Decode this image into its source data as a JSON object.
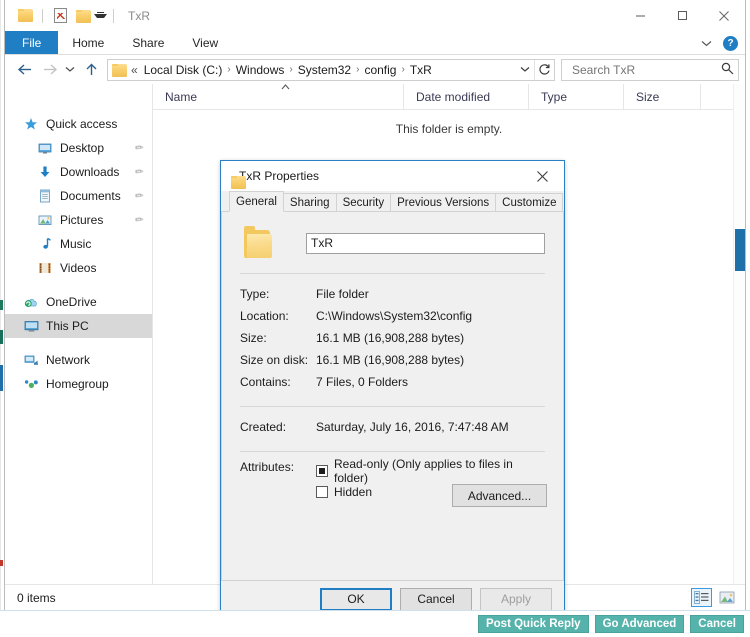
{
  "window": {
    "title": "TxR",
    "quick_access_toolbar": [
      {
        "name": "folder-icon",
        "tooltip": "TxR"
      },
      {
        "name": "properties-doc-icon",
        "tooltip": "Properties"
      },
      {
        "name": "new-folder-icon",
        "tooltip": "New folder"
      },
      {
        "name": "customize-caret-icon",
        "tooltip": "Customize Quick Access Toolbar"
      }
    ],
    "controls": {
      "minimize": "minimize-button",
      "maximize": "maximize-button",
      "close": "close-button"
    }
  },
  "ribbon": {
    "tabs": [
      {
        "label": "File",
        "active": true
      },
      {
        "label": "Home",
        "active": false
      },
      {
        "label": "Share",
        "active": false
      },
      {
        "label": "View",
        "active": false
      }
    ],
    "collapse_icon": "chevron-down-icon",
    "help_icon": "help-icon",
    "help_glyph": "?",
    "file_tab_color": "#1f7ec4"
  },
  "navigation": {
    "back_label": "Back",
    "forward_label": "Forward",
    "recent_label": "Recent locations",
    "up_label": "Up",
    "breadcrumb_prefix": "«",
    "breadcrumbs": [
      "Local Disk (C:)",
      "Windows",
      "System32",
      "config",
      "TxR"
    ],
    "separator": "›",
    "dropdown_icon": "chevron-down-icon",
    "refresh_icon": "refresh-icon"
  },
  "search": {
    "placeholder": "Search TxR",
    "value": "",
    "icon": "search-icon"
  },
  "sidebar": {
    "items": [
      {
        "label": "Quick access",
        "icon": "star-icon",
        "indent": false,
        "pinned": false,
        "selected": false
      },
      {
        "label": "Desktop",
        "icon": "desktop-icon",
        "indent": true,
        "pinned": true,
        "selected": false
      },
      {
        "label": "Downloads",
        "icon": "downloads-icon",
        "indent": true,
        "pinned": true,
        "selected": false
      },
      {
        "label": "Documents",
        "icon": "documents-icon",
        "indent": true,
        "pinned": true,
        "selected": false
      },
      {
        "label": "Pictures",
        "icon": "pictures-icon",
        "indent": true,
        "pinned": true,
        "selected": false
      },
      {
        "label": "Music",
        "icon": "music-icon",
        "indent": true,
        "pinned": false,
        "selected": false
      },
      {
        "label": "Videos",
        "icon": "videos-icon",
        "indent": true,
        "pinned": false,
        "selected": false
      },
      {
        "label": "OneDrive",
        "icon": "onedrive-icon",
        "indent": false,
        "pinned": false,
        "selected": false
      },
      {
        "label": "This PC",
        "icon": "this-pc-icon",
        "indent": false,
        "pinned": false,
        "selected": true
      },
      {
        "label": "Network",
        "icon": "network-icon",
        "indent": false,
        "pinned": false,
        "selected": false
      },
      {
        "label": "Homegroup",
        "icon": "homegroup-icon",
        "indent": false,
        "pinned": false,
        "selected": false
      }
    ]
  },
  "file_list": {
    "columns": [
      "Name",
      "Date modified",
      "Type",
      "Size"
    ],
    "sort_column": "Name",
    "sort_direction": "ascending",
    "rows": [],
    "empty_message": "This folder is empty."
  },
  "status_bar": {
    "item_count_text": "0 items",
    "view_buttons": [
      {
        "name": "details-view-button",
        "selected": true
      },
      {
        "name": "large-icons-view-button",
        "selected": false
      }
    ]
  },
  "dialog": {
    "title": "TxR Properties",
    "close_icon": "close-icon",
    "tabs": [
      {
        "label": "General",
        "active": true
      },
      {
        "label": "Sharing",
        "active": false
      },
      {
        "label": "Security",
        "active": false
      },
      {
        "label": "Previous Versions",
        "active": false
      },
      {
        "label": "Customize",
        "active": false
      }
    ],
    "folder_icon": "folder-icon",
    "name_value": "TxR",
    "properties": [
      {
        "label": "Type:",
        "value": "File folder"
      },
      {
        "label": "Location:",
        "value": "C:\\Windows\\System32\\config"
      },
      {
        "label": "Size:",
        "value": "16.1 MB (16,908,288 bytes)"
      },
      {
        "label": "Size on disk:",
        "value": "16.1 MB (16,908,288 bytes)"
      },
      {
        "label": "Contains:",
        "value": "7 Files, 0 Folders"
      }
    ],
    "created": {
      "label": "Created:",
      "value": "Saturday, July 16, 2016, 7:47:48 AM"
    },
    "attributes": {
      "label": "Attributes:",
      "readonly_label": "Read-only (Only applies to files in folder)",
      "readonly_state": "indeterminate",
      "hidden_label": "Hidden",
      "hidden_state": "unchecked",
      "advanced_label": "Advanced..."
    },
    "buttons": [
      {
        "label": "OK",
        "state": "focused"
      },
      {
        "label": "Cancel",
        "state": "enabled"
      },
      {
        "label": "Apply",
        "state": "disabled"
      }
    ]
  },
  "forum_bar": {
    "buttons": [
      "Post Quick Reply",
      "Go Advanced",
      "Cancel"
    ],
    "accent_color": "#56b3ab"
  }
}
